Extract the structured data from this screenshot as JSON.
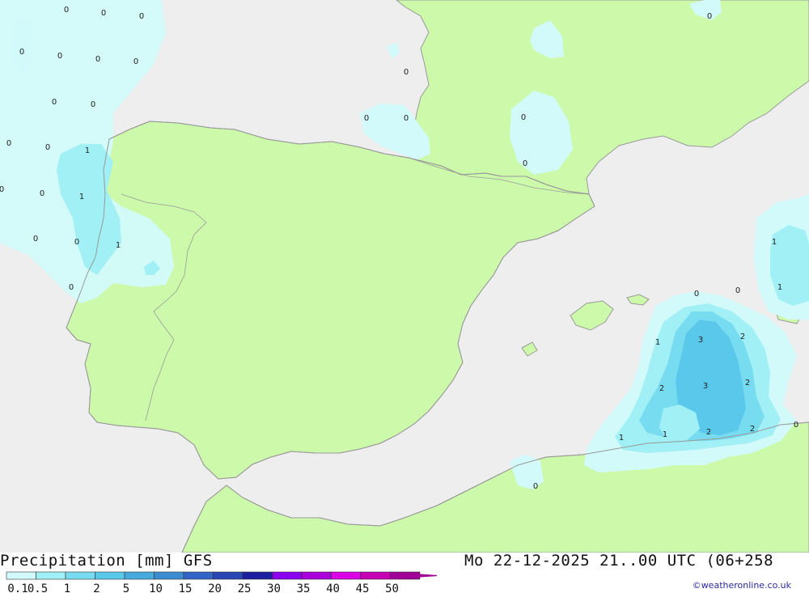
{
  "title": "Precipitation [mm] GFS",
  "datetime": "Mo 22-12-2025 21..00 UTC (06+258",
  "credit": "©weatheronline.co.uk",
  "colors": {
    "sea": "#eeeeee",
    "land": "#ccfaaa",
    "coast": "#999999",
    "level_0": "#d2fafa",
    "level_1": "#a0f0f5",
    "level_2": "#78dcf0",
    "level_3": "#5ac8eb"
  },
  "legend": {
    "labels": [
      "0.1",
      "0.5",
      "1",
      "2",
      "5",
      "10",
      "15",
      "20",
      "25",
      "30",
      "35",
      "40",
      "45",
      "50"
    ],
    "colors": [
      "#d2fafa",
      "#a0f0f5",
      "#78dcf0",
      "#5ac8eb",
      "#46aadc",
      "#3c8cd2",
      "#3264c8",
      "#2846b4",
      "#1e1ea0",
      "#8c00f0",
      "#aa00dc",
      "#dc00e6",
      "#c800b4",
      "#a00096"
    ]
  },
  "contour_labels": [
    {
      "text": "0"
    },
    {
      "text": "0"
    },
    {
      "text": "0"
    },
    {
      "text": "0"
    },
    {
      "text": "0"
    },
    {
      "text": "0"
    },
    {
      "text": "0"
    },
    {
      "text": "0"
    },
    {
      "text": "0"
    },
    {
      "text": "0"
    },
    {
      "text": "0"
    },
    {
      "text": "0"
    },
    {
      "text": "1"
    },
    {
      "text": "0"
    },
    {
      "text": "1"
    },
    {
      "text": "0"
    },
    {
      "text": "0"
    },
    {
      "text": "1"
    },
    {
      "text": "0"
    },
    {
      "text": "0"
    },
    {
      "text": "0"
    },
    {
      "text": "0"
    },
    {
      "text": "0"
    },
    {
      "text": "0"
    },
    {
      "text": "0"
    },
    {
      "text": "1"
    },
    {
      "text": "1"
    },
    {
      "text": "0"
    },
    {
      "text": "0"
    },
    {
      "text": "1"
    },
    {
      "text": "3"
    },
    {
      "text": "2"
    },
    {
      "text": "2"
    },
    {
      "text": "3"
    },
    {
      "text": "2"
    },
    {
      "text": "1"
    },
    {
      "text": "1"
    },
    {
      "text": "2"
    },
    {
      "text": "2"
    },
    {
      "text": "0"
    },
    {
      "text": "0"
    }
  ]
}
